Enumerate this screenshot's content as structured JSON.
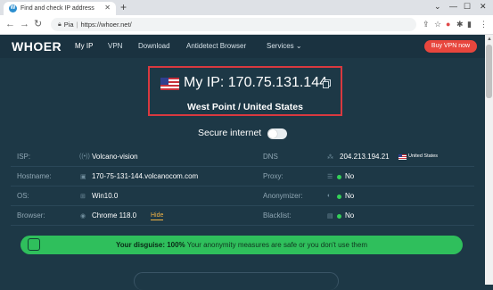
{
  "browser": {
    "tab_title": "Find and check IP address",
    "tab_favicon": "W",
    "new_tab": "+",
    "url_site": "Pia",
    "url": "https://whoer.net/",
    "window_controls": [
      "⌄",
      "—",
      "☐",
      "✕"
    ]
  },
  "nav": {
    "logo": "WHOER",
    "links": [
      "My IP",
      "VPN",
      "Download",
      "Antidetect Browser",
      "Services ⌄"
    ],
    "buy_vpn": "Buy VPN now"
  },
  "ip": {
    "label": "My IP: 170.75.131.144",
    "location": "West Point / United States"
  },
  "secure": {
    "label": "Secure internet",
    "enabled": false
  },
  "left_rows": [
    {
      "label": "ISP:",
      "value": "Volcano-vision"
    },
    {
      "label": "Hostname:",
      "value": "170-75-131-144.volcanocom.com"
    },
    {
      "label": "OS:",
      "value": "Win10.0"
    },
    {
      "label": "Browser:",
      "value": "Chrome 118.0"
    }
  ],
  "hide_link": "Hide",
  "right_rows": [
    {
      "label": "DNS",
      "value": "204.213.194.21"
    },
    {
      "label": "Proxy:",
      "value": "No"
    },
    {
      "label": "Anonymizer:",
      "value": "No"
    },
    {
      "label": "Blacklist:",
      "value": "No"
    }
  ],
  "dns_country": "United States",
  "disguise": {
    "prefix": "Your disguise: 100%",
    "text": " Your anonymity measures are safe or you don't use them"
  },
  "colors": {
    "background": "#1d3846",
    "accent_red": "#e8463d",
    "highlight_box": "#d9393f",
    "status_green": "#2fbf5c"
  }
}
